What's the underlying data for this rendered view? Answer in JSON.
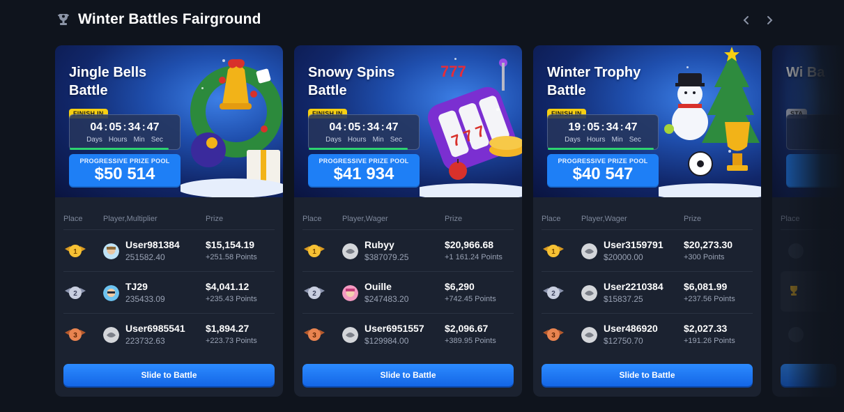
{
  "page": {
    "title": "Winter Battles Fairground"
  },
  "cards": [
    {
      "title": "Jingle Bells Battle",
      "timer_label": "FINISH IN",
      "timer": {
        "days": "04",
        "hours": "05",
        "minutes": "34",
        "seconds": "47"
      },
      "timer_units": {
        "days": "Days",
        "hours": "Hours",
        "minutes": "Min",
        "seconds": "Sec"
      },
      "timer_progress": 0.9,
      "pool_label": "PROGRESSIVE PRIZE POOL",
      "pool_amount": "$50 514",
      "columns": {
        "place": "Place",
        "player": "Player,Multiplier",
        "prize": "Prize"
      },
      "rows": [
        {
          "place": 1,
          "name": "User981384",
          "sub": "251582.40",
          "prize": "$15,154.19",
          "points": "+251.58 Points"
        },
        {
          "place": 2,
          "name": "TJ29",
          "sub": "235433.09",
          "prize": "$4,041.12",
          "points": "+235.43 Points"
        },
        {
          "place": 3,
          "name": "User6985541",
          "sub": "223732.63",
          "prize": "$1,894.27",
          "points": "+223.73 Points"
        }
      ],
      "button": "Slide to Battle"
    },
    {
      "title": "Snowy Spins Battle",
      "timer_label": "FINISH IN",
      "timer": {
        "days": "04",
        "hours": "05",
        "minutes": "34",
        "seconds": "47"
      },
      "timer_units": {
        "days": "Days",
        "hours": "Hours",
        "minutes": "Min",
        "seconds": "Sec"
      },
      "timer_progress": 0.9,
      "pool_label": "PROGRESSIVE PRIZE POOL",
      "pool_amount": "$41 934",
      "columns": {
        "place": "Place",
        "player": "Player,Wager",
        "prize": "Prize"
      },
      "rows": [
        {
          "place": 1,
          "name": "Rubyy",
          "sub": "$387079.25",
          "prize": "$20,966.68",
          "points": "+1 161.24 Points"
        },
        {
          "place": 2,
          "name": "Ouille",
          "sub": "$247483.20",
          "prize": "$6,290",
          "points": "+742.45 Points"
        },
        {
          "place": 3,
          "name": "User6951557",
          "sub": "$129984.00",
          "prize": "$2,096.67",
          "points": "+389.95 Points"
        }
      ],
      "button": "Slide to Battle"
    },
    {
      "title": "Winter Trophy Battle",
      "timer_label": "FINISH IN",
      "timer": {
        "days": "19",
        "hours": "05",
        "minutes": "34",
        "seconds": "47"
      },
      "timer_units": {
        "days": "Days",
        "hours": "Hours",
        "minutes": "Min",
        "seconds": "Sec"
      },
      "timer_progress": 0.96,
      "pool_label": "PROGRESSIVE PRIZE POOL",
      "pool_amount": "$40 547",
      "columns": {
        "place": "Place",
        "player": "Player,Wager",
        "prize": "Prize"
      },
      "rows": [
        {
          "place": 1,
          "name": "User3159791",
          "sub": "$20000.00",
          "prize": "$20,273.30",
          "points": "+300 Points"
        },
        {
          "place": 2,
          "name": "User2210384",
          "sub": "$15837.25",
          "prize": "$6,081.99",
          "points": "+237.56 Points"
        },
        {
          "place": 3,
          "name": "User486920",
          "sub": "$12750.70",
          "prize": "$2,027.33",
          "points": "+191.26 Points"
        }
      ],
      "button": "Slide to Battle"
    }
  ],
  "partial_card": {
    "title": "Wi Ba",
    "timer_label": "STA",
    "columns": {
      "place": "Place"
    }
  },
  "colors": {
    "background": "#0f141d",
    "card": "#1b2230",
    "accent": "#1e7ff6",
    "timer_tag": "#f6cf12",
    "progress": "#2dd36f"
  }
}
